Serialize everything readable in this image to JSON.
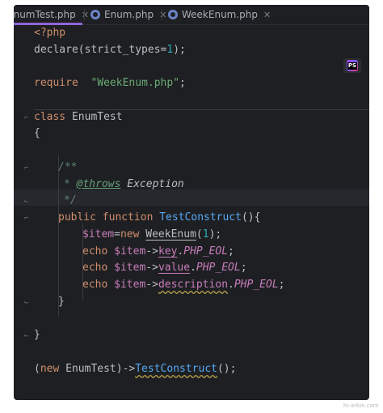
{
  "tabs": [
    {
      "label": "EnumTest.php",
      "active": true
    },
    {
      "label": "Enum.php",
      "active": false
    },
    {
      "label": "WeekEnum.php",
      "active": false
    }
  ],
  "code": {
    "php_open": "<?php",
    "declare_line": {
      "pre": "declare(strict_types=",
      "num": "1",
      "post": ");"
    },
    "require_line": {
      "kw": "require",
      "str": "\"WeekEnum.php\"",
      "post": ";"
    },
    "class_line": {
      "kw": "class",
      "name": " EnumTest"
    },
    "open_brace": "{",
    "doc_open": "/**",
    "doc_throws": {
      "star": "* ",
      "tag": "@throws",
      "type": " Exception"
    },
    "doc_close": "*/",
    "method_line": {
      "kw": "public function",
      "name": "TestConstruct",
      "post": "(){"
    },
    "line_new": {
      "var": "$item",
      "eq": "=",
      "kw": "new",
      "cls": "WeekEnum",
      "open": "(",
      "num": "1",
      "close": ");"
    },
    "echo_key": {
      "kw": "echo",
      "var": "$item",
      "arrow": "->",
      "prop": "key",
      "dot": ".",
      "const": "PHP_EOL",
      "end": ";"
    },
    "echo_value": {
      "kw": "echo",
      "var": "$item",
      "arrow": "->",
      "prop": "value",
      "dot": ".",
      "const": "PHP_EOL",
      "end": ";"
    },
    "echo_desc": {
      "kw": "echo",
      "var": "$item",
      "arrow": "->",
      "prop": "description",
      "dot": ".",
      "const": "PHP_EOL",
      "end": ";"
    },
    "method_close": "}",
    "class_close": "}",
    "call_line": {
      "open": "(",
      "kw": "new",
      "cls": " EnumTest)->",
      "fn": "TestConstruct",
      "post": "();"
    }
  },
  "badge": {
    "label": "PS"
  },
  "watermark": "hi-arkin.com",
  "colors": {
    "background": "#1e1f22",
    "keyword": "#cf8e6d",
    "string": "#6aab73",
    "number": "#2aacb8",
    "variable": "#c77dbb",
    "function": "#56a8f5",
    "active_tab": "#8f65d9"
  }
}
